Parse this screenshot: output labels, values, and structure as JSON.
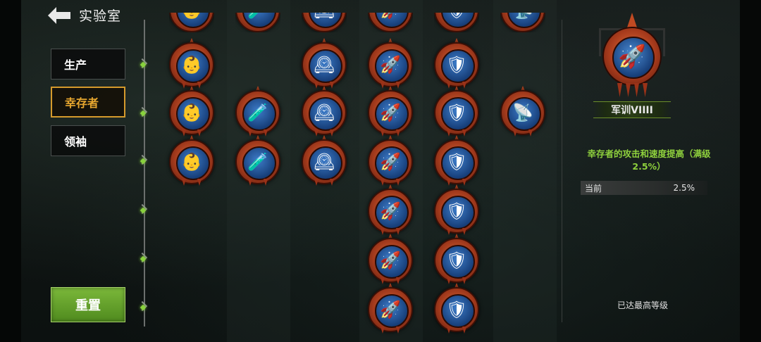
{
  "header": {
    "title": "实验室",
    "back_icon": "back-arrow-icon"
  },
  "tabs": [
    {
      "label": "生产",
      "active": false
    },
    {
      "label": "幸存者",
      "active": true
    },
    {
      "label": "领袖",
      "active": false
    }
  ],
  "reset_button": {
    "label": "重置",
    "color": "#6aa32d"
  },
  "skill_tree": {
    "columns": [
      {
        "icon": "survivor-portrait-icon",
        "rows": 3
      },
      {
        "icon": "supply-canister-icon",
        "rows": 2
      },
      {
        "icon": "pocket-watch-icon",
        "rows": 3
      },
      {
        "icon": "bullet-icon",
        "rows": 7
      },
      {
        "icon": "shield-medkit-icon",
        "rows": 7
      },
      {
        "icon": "radar-dish-icon",
        "rows": 1
      }
    ]
  },
  "detail": {
    "icon": "bullet-icon",
    "name": "军训VIIII",
    "description": "幸存者的攻击和速度提高（满级 2.5%）",
    "stat_label": "当前",
    "stat_value": "2.5%",
    "status": "已达最高等级"
  },
  "colors": {
    "accent": "#e7a72f",
    "description_green": "#8fd13d",
    "node_green": "#89d23d"
  }
}
